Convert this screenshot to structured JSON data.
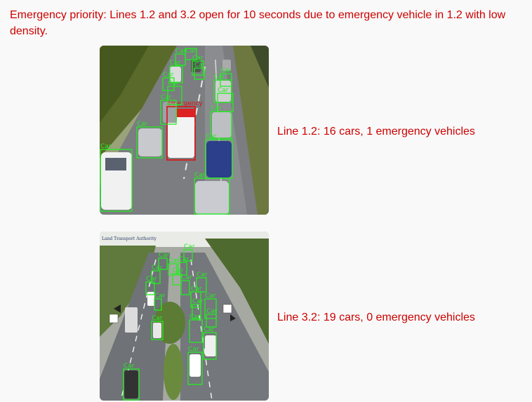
{
  "alert_message": "Emergency priority: Lines 1.2 and 3.2 open for 10 seconds due to emergency vehicle in 1.2 with low density.",
  "colors": {
    "alert_text": "#cc0000",
    "detection_box": "#22ee22",
    "emergency_box": "#e01010",
    "background": "#f9f9f9"
  },
  "feeds": [
    {
      "line": "1.2",
      "summary": "Line 1.2: 16 cars, 1 emergency vehicles",
      "car_label": "Car",
      "emergency_label": "Emergency"
    },
    {
      "line": "3.2",
      "summary": "Line 3.2: 19 cars, 0 emergency vehicles",
      "car_label": "Car",
      "camera_watermark": "Land Transport Authority"
    }
  ]
}
